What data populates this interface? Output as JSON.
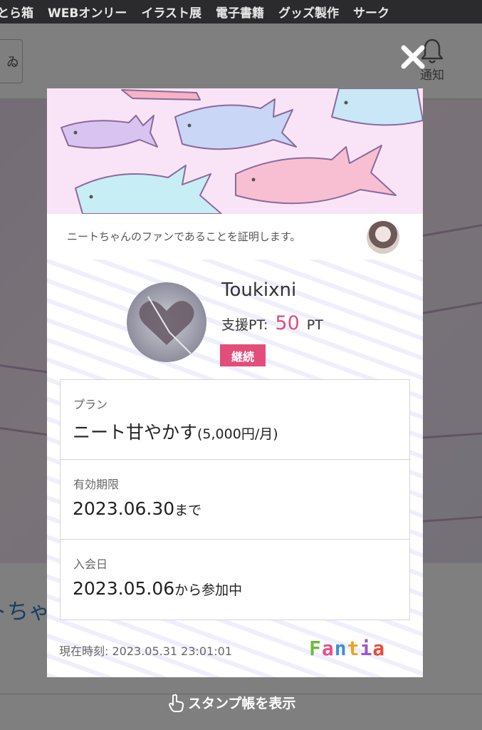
{
  "nav": {
    "items": [
      "とら箱",
      "WEBオンリー",
      "イラスト展",
      "電子書籍",
      "グッズ製作",
      "サーク"
    ]
  },
  "header": {
    "search_glyph": "ゐ",
    "notification_label": "通知"
  },
  "under_page": {
    "partial_text": "トちゃ"
  },
  "modal": {
    "certificate_text": "ニートちゃんのファンであることを証明します。",
    "fan": {
      "name": "Toukixni",
      "points_label": "支援PT:",
      "points_value": "50",
      "points_unit": "PT",
      "status_badge": "継続"
    },
    "plan": {
      "label": "プラン",
      "name": "ニート甘やかす",
      "price": "(5,000円/月)"
    },
    "expiry": {
      "label": "有効期限",
      "date": "2023.06.30",
      "suffix": "まで"
    },
    "joined": {
      "label": "入会日",
      "date": "2023.05.06",
      "suffix": "から参加中"
    },
    "current_time": "現在時刻: 2023.05.31 23:01:01",
    "logo_letters": [
      "F",
      "a",
      "n",
      "t",
      "i",
      "a"
    ],
    "logo_colors": [
      "#6bbf3a",
      "#e84f88",
      "#3e8edb",
      "#f2a01f",
      "#9b59c6",
      "#e94a3b"
    ]
  },
  "footer": {
    "stamp_link": "スタンプ帳を表示"
  },
  "colors": {
    "accent_pink": "#e24d7a",
    "nav_bg": "#2b2b2d"
  }
}
